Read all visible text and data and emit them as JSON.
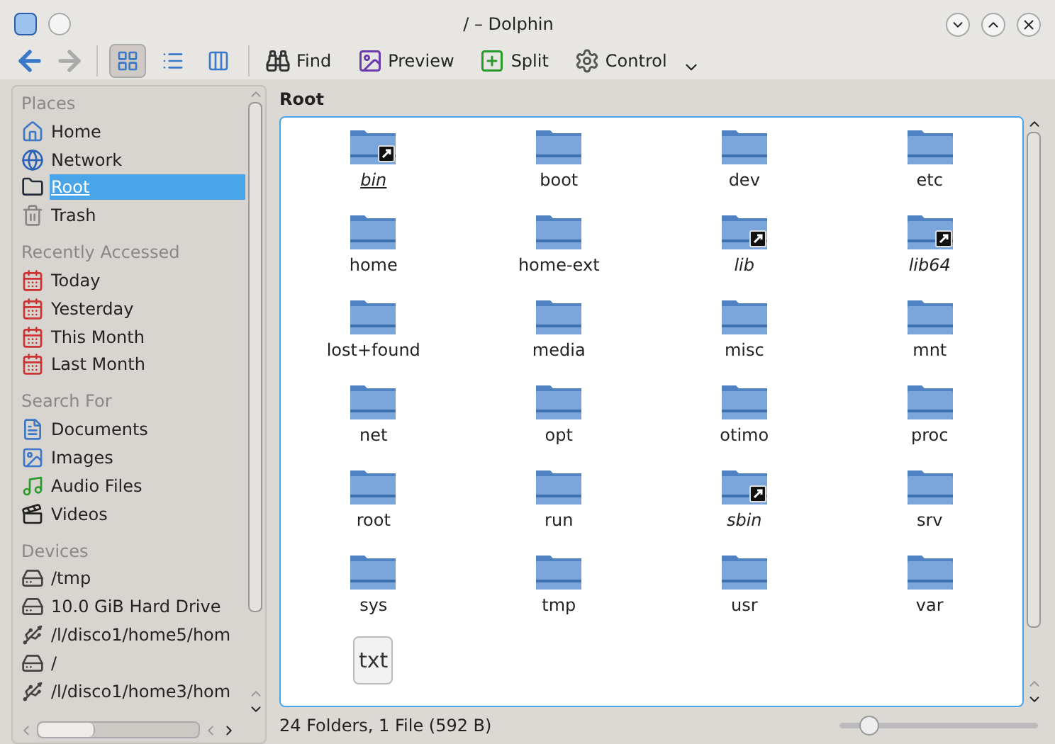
{
  "window": {
    "title": "/ – Dolphin"
  },
  "toolbar": {
    "view_modes": [
      {
        "kind": "icons",
        "selected": true
      },
      {
        "kind": "details",
        "selected": false
      },
      {
        "kind": "columns",
        "selected": false
      }
    ],
    "buttons": [
      {
        "kind": "find",
        "label": "Find"
      },
      {
        "kind": "preview",
        "label": "Preview"
      },
      {
        "kind": "split",
        "label": "Split"
      },
      {
        "kind": "control",
        "label": "Control"
      }
    ]
  },
  "sidebar": {
    "sections": [
      {
        "title": "Places",
        "items": [
          {
            "kind": "home",
            "label": "Home",
            "selected": false
          },
          {
            "kind": "network",
            "label": "Network",
            "selected": false
          },
          {
            "kind": "root",
            "label": "Root",
            "selected": true
          },
          {
            "kind": "trash",
            "label": "Trash",
            "selected": false
          }
        ]
      },
      {
        "title": "Recently Accessed",
        "items": [
          {
            "kind": "calendar",
            "label": "Today",
            "selected": false
          },
          {
            "kind": "calendar",
            "label": "Yesterday",
            "selected": false
          },
          {
            "kind": "calendar",
            "label": "This Month",
            "selected": false
          },
          {
            "kind": "calendar",
            "label": "Last Month",
            "selected": false
          }
        ]
      },
      {
        "title": "Search For",
        "items": [
          {
            "kind": "documents",
            "label": "Documents",
            "selected": false
          },
          {
            "kind": "images",
            "label": "Images",
            "selected": false
          },
          {
            "kind": "audio",
            "label": "Audio Files",
            "selected": false
          },
          {
            "kind": "videos",
            "label": "Videos",
            "selected": false
          }
        ]
      },
      {
        "title": "Devices",
        "items": [
          {
            "kind": "drive",
            "label": "/tmp",
            "selected": false
          },
          {
            "kind": "drive",
            "label": "10.0 GiB Hard Drive",
            "selected": false
          },
          {
            "kind": "remote",
            "label": "/l/disco1/home5/hom",
            "selected": false
          },
          {
            "kind": "drive",
            "label": "/",
            "selected": false
          },
          {
            "kind": "remote",
            "label": "/l/disco1/home3/hom",
            "selected": false
          }
        ]
      }
    ]
  },
  "location": "Root",
  "files": [
    {
      "kind": "folder",
      "name": "bin",
      "link": true,
      "hovered": true
    },
    {
      "kind": "folder",
      "name": "boot",
      "link": false,
      "hovered": false
    },
    {
      "kind": "folder",
      "name": "dev",
      "link": false,
      "hovered": false
    },
    {
      "kind": "folder",
      "name": "etc",
      "link": false,
      "hovered": false
    },
    {
      "kind": "folder",
      "name": "home",
      "link": false,
      "hovered": false
    },
    {
      "kind": "folder",
      "name": "home-ext",
      "link": false,
      "hovered": false
    },
    {
      "kind": "folder",
      "name": "lib",
      "link": true,
      "hovered": false
    },
    {
      "kind": "folder",
      "name": "lib64",
      "link": true,
      "hovered": false
    },
    {
      "kind": "folder",
      "name": "lost+found",
      "link": false,
      "hovered": false
    },
    {
      "kind": "folder",
      "name": "media",
      "link": false,
      "hovered": false
    },
    {
      "kind": "folder",
      "name": "misc",
      "link": false,
      "hovered": false
    },
    {
      "kind": "folder",
      "name": "mnt",
      "link": false,
      "hovered": false
    },
    {
      "kind": "folder",
      "name": "net",
      "link": false,
      "hovered": false
    },
    {
      "kind": "folder",
      "name": "opt",
      "link": false,
      "hovered": false
    },
    {
      "kind": "folder",
      "name": "otimo",
      "link": false,
      "hovered": false
    },
    {
      "kind": "folder",
      "name": "proc",
      "link": false,
      "hovered": false
    },
    {
      "kind": "folder",
      "name": "root",
      "link": false,
      "hovered": false
    },
    {
      "kind": "folder",
      "name": "run",
      "link": false,
      "hovered": false
    },
    {
      "kind": "folder",
      "name": "sbin",
      "link": true,
      "hovered": false
    },
    {
      "kind": "folder",
      "name": "srv",
      "link": false,
      "hovered": false
    },
    {
      "kind": "folder",
      "name": "sys",
      "link": false,
      "hovered": false
    },
    {
      "kind": "folder",
      "name": "tmp",
      "link": false,
      "hovered": false
    },
    {
      "kind": "folder",
      "name": "usr",
      "link": false,
      "hovered": false
    },
    {
      "kind": "folder",
      "name": "var",
      "link": false,
      "hovered": false
    },
    {
      "kind": "file",
      "icon_text": "txt"
    }
  ],
  "status_bar": {
    "text": "24 Folders, 1 File (592 B)",
    "zoom": {
      "level": 0.15
    }
  }
}
